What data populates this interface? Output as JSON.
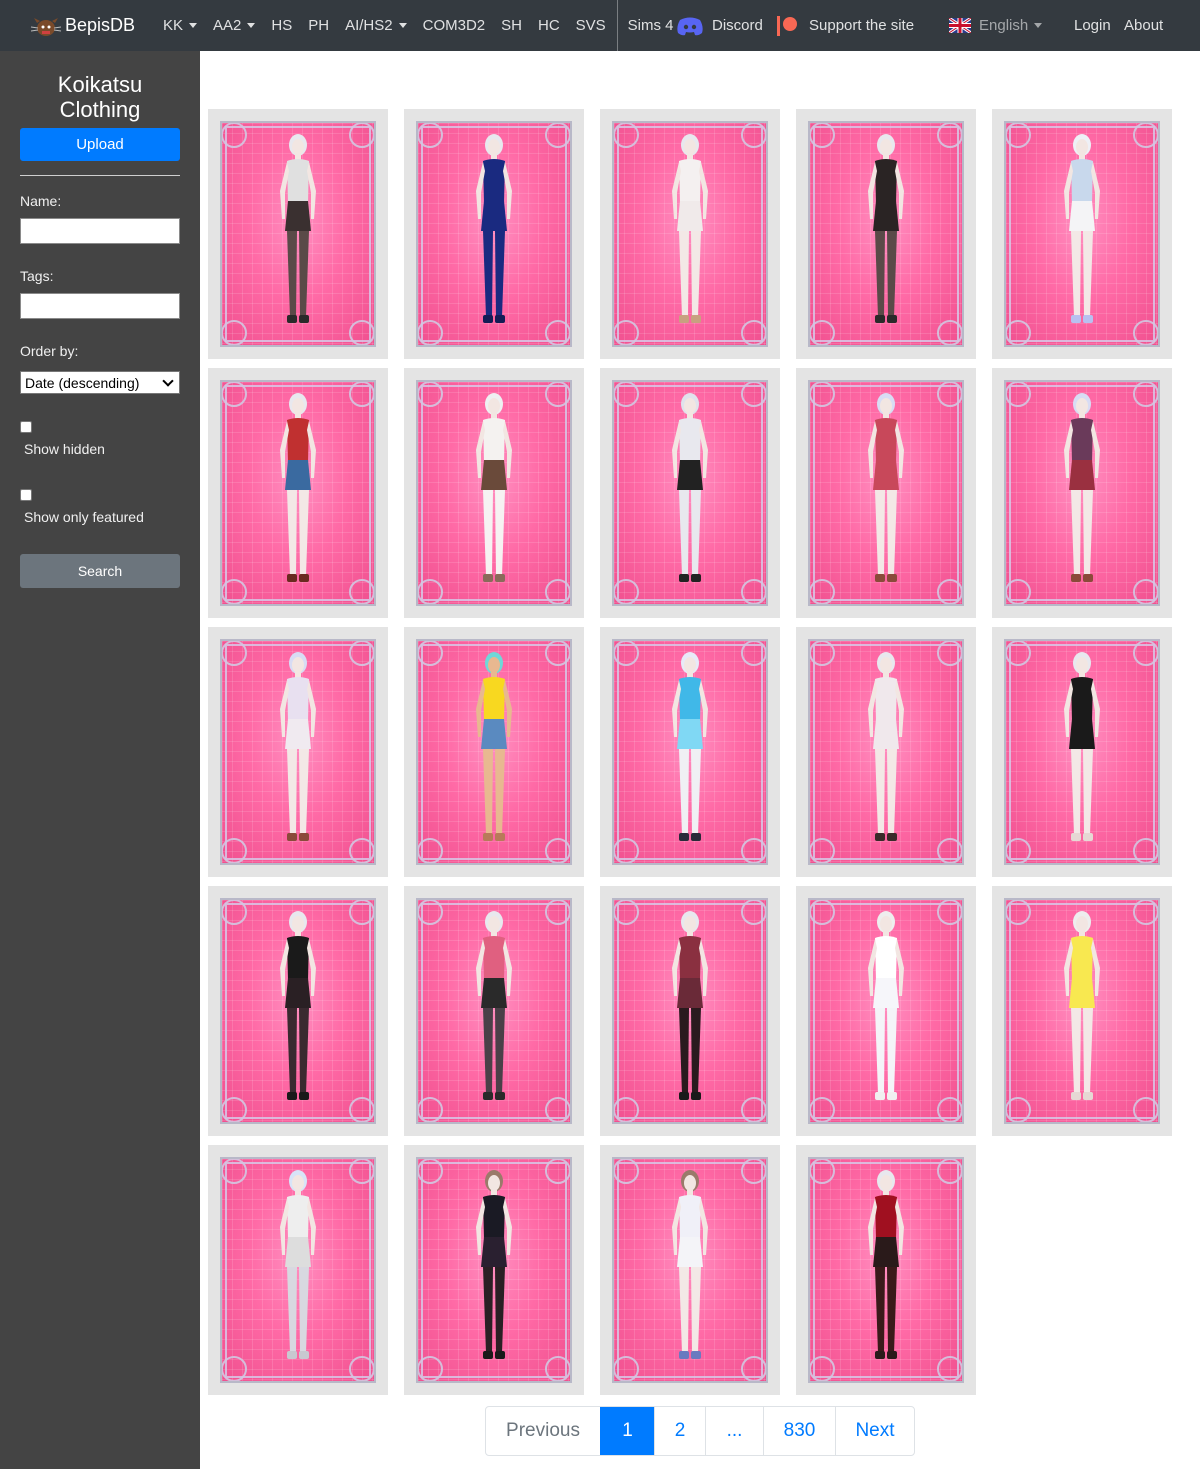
{
  "navbar": {
    "brand": "BepisDB",
    "items": [
      {
        "label": "KK",
        "dropdown": true
      },
      {
        "label": "AA2",
        "dropdown": true
      },
      {
        "label": "HS",
        "dropdown": false
      },
      {
        "label": "PH",
        "dropdown": false
      },
      {
        "label": "AI/HS2",
        "dropdown": true
      },
      {
        "label": "COM3D2",
        "dropdown": false
      },
      {
        "label": "SH",
        "dropdown": false
      },
      {
        "label": "HC",
        "dropdown": false
      },
      {
        "label": "SVS",
        "dropdown": false
      }
    ],
    "sims": "Sims 4",
    "discord": "Discord",
    "support": "Support the site",
    "language": "English",
    "login": "Login",
    "about": "About"
  },
  "sidebar": {
    "title": "Koikatsu Clothing",
    "upload_label": "Upload",
    "name_label": "Name:",
    "name_value": "",
    "tags_label": "Tags:",
    "tags_value": "",
    "order_label": "Order by:",
    "order_value": "Date (descending)",
    "show_hidden_label": "Show hidden",
    "show_hidden_checked": false,
    "show_featured_label": "Show only featured",
    "show_featured_checked": false,
    "search_label": "Search"
  },
  "cards": [
    {
      "hair": "#e8e8ee",
      "top": "#e0e0e0",
      "bottom": "#3a3030",
      "legs": "#5a4a48",
      "shoes": "#2a2a2a",
      "skin": "#f2e6e2"
    },
    {
      "hair": "#e8e8ee",
      "top": "#1a2a80",
      "bottom": "#1a2a80",
      "legs": "#1a2a80",
      "shoes": "#141c55",
      "skin": "#f2e6e2"
    },
    {
      "hair": "#e8e8ee",
      "top": "#f4f0f0",
      "bottom": "#f0eaea",
      "legs": "#f3e8e6",
      "shoes": "#c8a080",
      "skin": "#f2e6e2"
    },
    {
      "hair": "#e8e8ee",
      "top": "#2a2424",
      "bottom": "#2a2424",
      "legs": "#5a4a48",
      "shoes": "#2a2a2a",
      "skin": "#f2e6e2"
    },
    {
      "hair": "#eef0f6",
      "top": "#c8d8ec",
      "bottom": "#f4f4f6",
      "legs": "#f3e8e6",
      "shoes": "#b8c0f0",
      "skin": "#f2e6e2"
    },
    {
      "hair": "#e8e8ee",
      "top": "#c03030",
      "bottom": "#3a6aa0",
      "legs": "#f3e8e6",
      "shoes": "#6a2a20",
      "skin": "#f2e6e2"
    },
    {
      "hair": "#eef0f2",
      "top": "#f4f2f0",
      "bottom": "#6a4a3a",
      "legs": "#f6f2f2",
      "shoes": "#8a6a5a",
      "skin": "#f2e6e2"
    },
    {
      "hair": "#e0e2ec",
      "top": "#e8e8ee",
      "bottom": "#222222",
      "legs": "#e8e8ee",
      "shoes": "#222222",
      "skin": "#f2e6e2"
    },
    {
      "hair": "#d8dcf4",
      "top": "#c8485a",
      "bottom": "#c8485a",
      "legs": "#f3e8e6",
      "shoes": "#8a4a3a",
      "skin": "#f2e6e2"
    },
    {
      "hair": "#d8dcf4",
      "top": "#6a3a5a",
      "bottom": "#9a3040",
      "legs": "#f3e8e6",
      "shoes": "#8a4a3a",
      "skin": "#f2e6e2"
    },
    {
      "hair": "#d8dcf4",
      "top": "#e8e0f0",
      "bottom": "#f0eaf0",
      "legs": "#f3e8e6",
      "shoes": "#8a4a3a",
      "skin": "#f2e6e2"
    },
    {
      "hair": "#6fd8d8",
      "top": "#f8d820",
      "bottom": "#5a8ac0",
      "legs": "#e8b890",
      "shoes": "#b87a5a",
      "skin": "#e8b890"
    },
    {
      "hair": "#e8eaf8",
      "top": "#40b8e8",
      "bottom": "#80d8f4",
      "legs": "#f0f0f4",
      "shoes": "#2a2a3a",
      "skin": "#f2e6e2"
    },
    {
      "hair": "#e8e8ee",
      "top": "#f0e8ec",
      "bottom": "#f0e8ec",
      "legs": "#f3e8e6",
      "shoes": "#3a2a2a",
      "skin": "#f2e6e2"
    },
    {
      "hair": "#e8e8ee",
      "top": "#1a1a1a",
      "bottom": "#1a1a1a",
      "legs": "#f3e8e6",
      "shoes": "#e6d8d4",
      "skin": "#f2e6e2"
    },
    {
      "hair": "#e8e8ee",
      "top": "#1a1a1a",
      "bottom": "#2a2024",
      "legs": "#3a2a30",
      "shoes": "#1a1a1a",
      "skin": "#f2e6e2"
    },
    {
      "hair": "#e8e8ee",
      "top": "#e06080",
      "bottom": "#2a2a2a",
      "legs": "#4a4048",
      "shoes": "#2a2a2a",
      "skin": "#f2e6e2"
    },
    {
      "hair": "#e8e8ee",
      "top": "#8a3040",
      "bottom": "#6a2a38",
      "legs": "#2a1a1e",
      "shoes": "#1a1a1a",
      "skin": "#f2e6e2"
    },
    {
      "hair": "#eeeeee",
      "top": "#ffffff",
      "bottom": "#f6f6fa",
      "legs": "#f4f4f8",
      "shoes": "#f0f0f0",
      "skin": "#f2e6e2"
    },
    {
      "hair": "#eeeeee",
      "top": "#f8e850",
      "bottom": "#f8e850",
      "legs": "#f3e8e6",
      "shoes": "#e6d8d4",
      "skin": "#f2e6e2"
    },
    {
      "hair": "#d8e4f8",
      "top": "#eeeeee",
      "bottom": "#dddddd",
      "legs": "#d8d8e0",
      "shoes": "#c8c8d0",
      "skin": "#f2e6e2"
    },
    {
      "hair": "#9a7a6a",
      "top": "#1a1a24",
      "bottom": "#2a2030",
      "legs": "#2a2024",
      "shoes": "#1a1a1a",
      "skin": "#f2e6e2"
    },
    {
      "hair": "#9a7a6a",
      "top": "#f0f0f8",
      "bottom": "#f4f4f8",
      "legs": "#f3e8e6",
      "shoes": "#6a7ac0",
      "skin": "#f2e6e2"
    },
    {
      "hair": "#e8e8ee",
      "top": "#a01020",
      "bottom": "#2a1a1a",
      "legs": "#3a1a1a",
      "shoes": "#2a1a1a",
      "skin": "#f2e6e2"
    }
  ],
  "pagination": {
    "previous": "Previous",
    "pages": [
      "1",
      "2",
      "...",
      "830"
    ],
    "active_page": "1",
    "next": "Next"
  },
  "colors": {
    "navbar_bg": "#343a40",
    "sidebar_bg": "#444444",
    "primary": "#007bff",
    "secondary": "#6c757d",
    "card_bg": "#e4e4e4",
    "card_pink": "#ff6aa6"
  }
}
